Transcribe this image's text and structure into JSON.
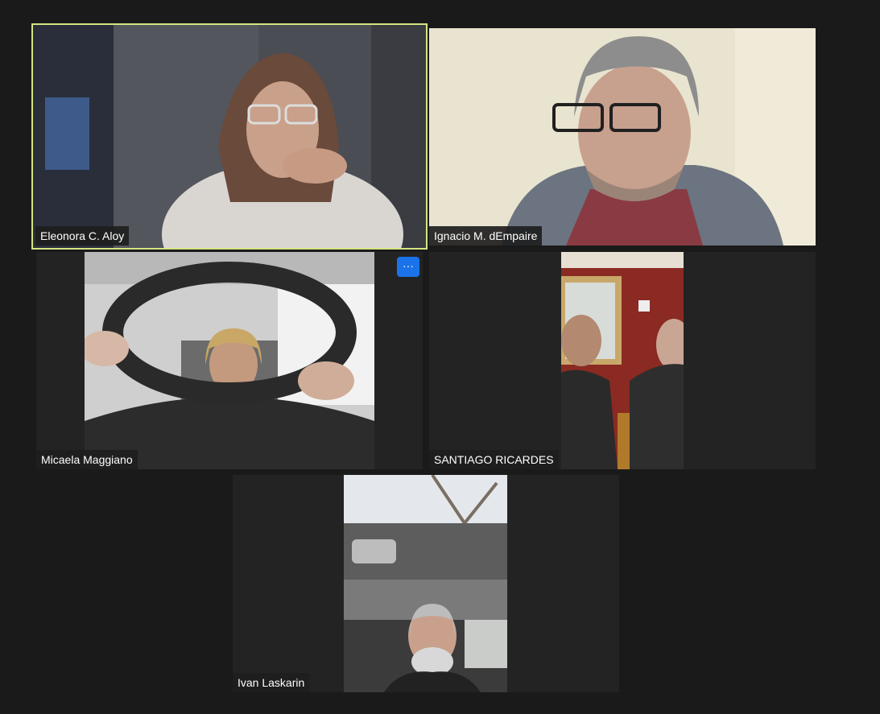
{
  "participants": [
    {
      "name": "Eleonora C. Aloy",
      "active_speaker": true
    },
    {
      "name": "Ignacio M. dEmpaire",
      "active_speaker": false
    },
    {
      "name": "Micaela Maggiano",
      "active_speaker": false,
      "more_button": "···"
    },
    {
      "name": "SANTIAGO RICARDES",
      "active_speaker": false
    },
    {
      "name": "Ivan Laskarin",
      "active_speaker": false
    }
  ],
  "colors": {
    "background": "#1a1a1a",
    "tile": "#232323",
    "active_border": "#d4e682",
    "more_button": "#1a73e8"
  },
  "icons": {
    "more_options": "more-horizontal-icon"
  }
}
